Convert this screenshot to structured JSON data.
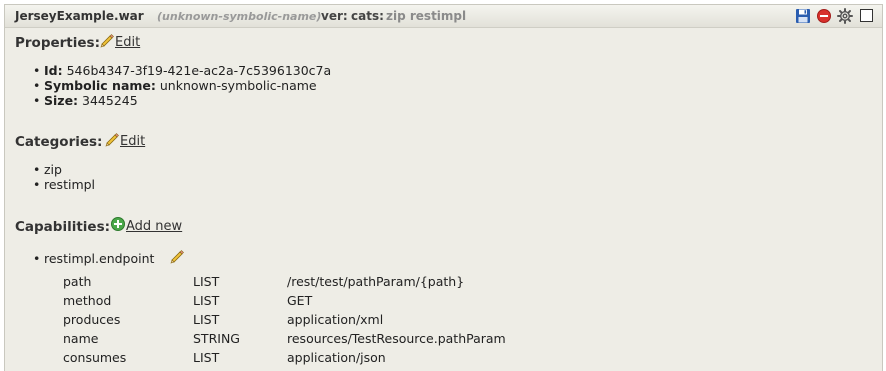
{
  "header": {
    "file_name": "JerseyExample.war",
    "symbolic_name": "(unknown-symbolic-name)",
    "version_label": "ver:",
    "categories_label": "cats:",
    "categories_value": "zip restimpl",
    "icons": [
      "save-icon",
      "delete-icon",
      "settings-icon",
      "checkbox"
    ]
  },
  "properties": {
    "heading": "Properties:",
    "edit_label": " Edit",
    "items": [
      {
        "label": "Id:",
        "value": " 546b4347-3f19-421e-ac2a-7c5396130c7a"
      },
      {
        "label": "Symbolic name:",
        "value": " unknown-symbolic-name"
      },
      {
        "label": "Size:",
        "value": " 3445245"
      }
    ]
  },
  "categories": {
    "heading": "Categories:",
    "edit_label": " Edit",
    "items": [
      "zip",
      "restimpl"
    ]
  },
  "capabilities": {
    "heading": "Capabilities:",
    "add_label": " Add new",
    "items": [
      {
        "name": "restimpl.endpoint",
        "attributes": [
          {
            "name": "path",
            "type": "LIST",
            "value": "/rest/test/pathParam/{path}"
          },
          {
            "name": "method",
            "type": "LIST",
            "value": "GET"
          },
          {
            "name": "produces",
            "type": "LIST",
            "value": "application/xml"
          },
          {
            "name": "name",
            "type": "STRING",
            "value": "resources/TestResource.pathParam"
          },
          {
            "name": "consumes",
            "type": "LIST",
            "value": "application/json"
          }
        ]
      }
    ]
  }
}
